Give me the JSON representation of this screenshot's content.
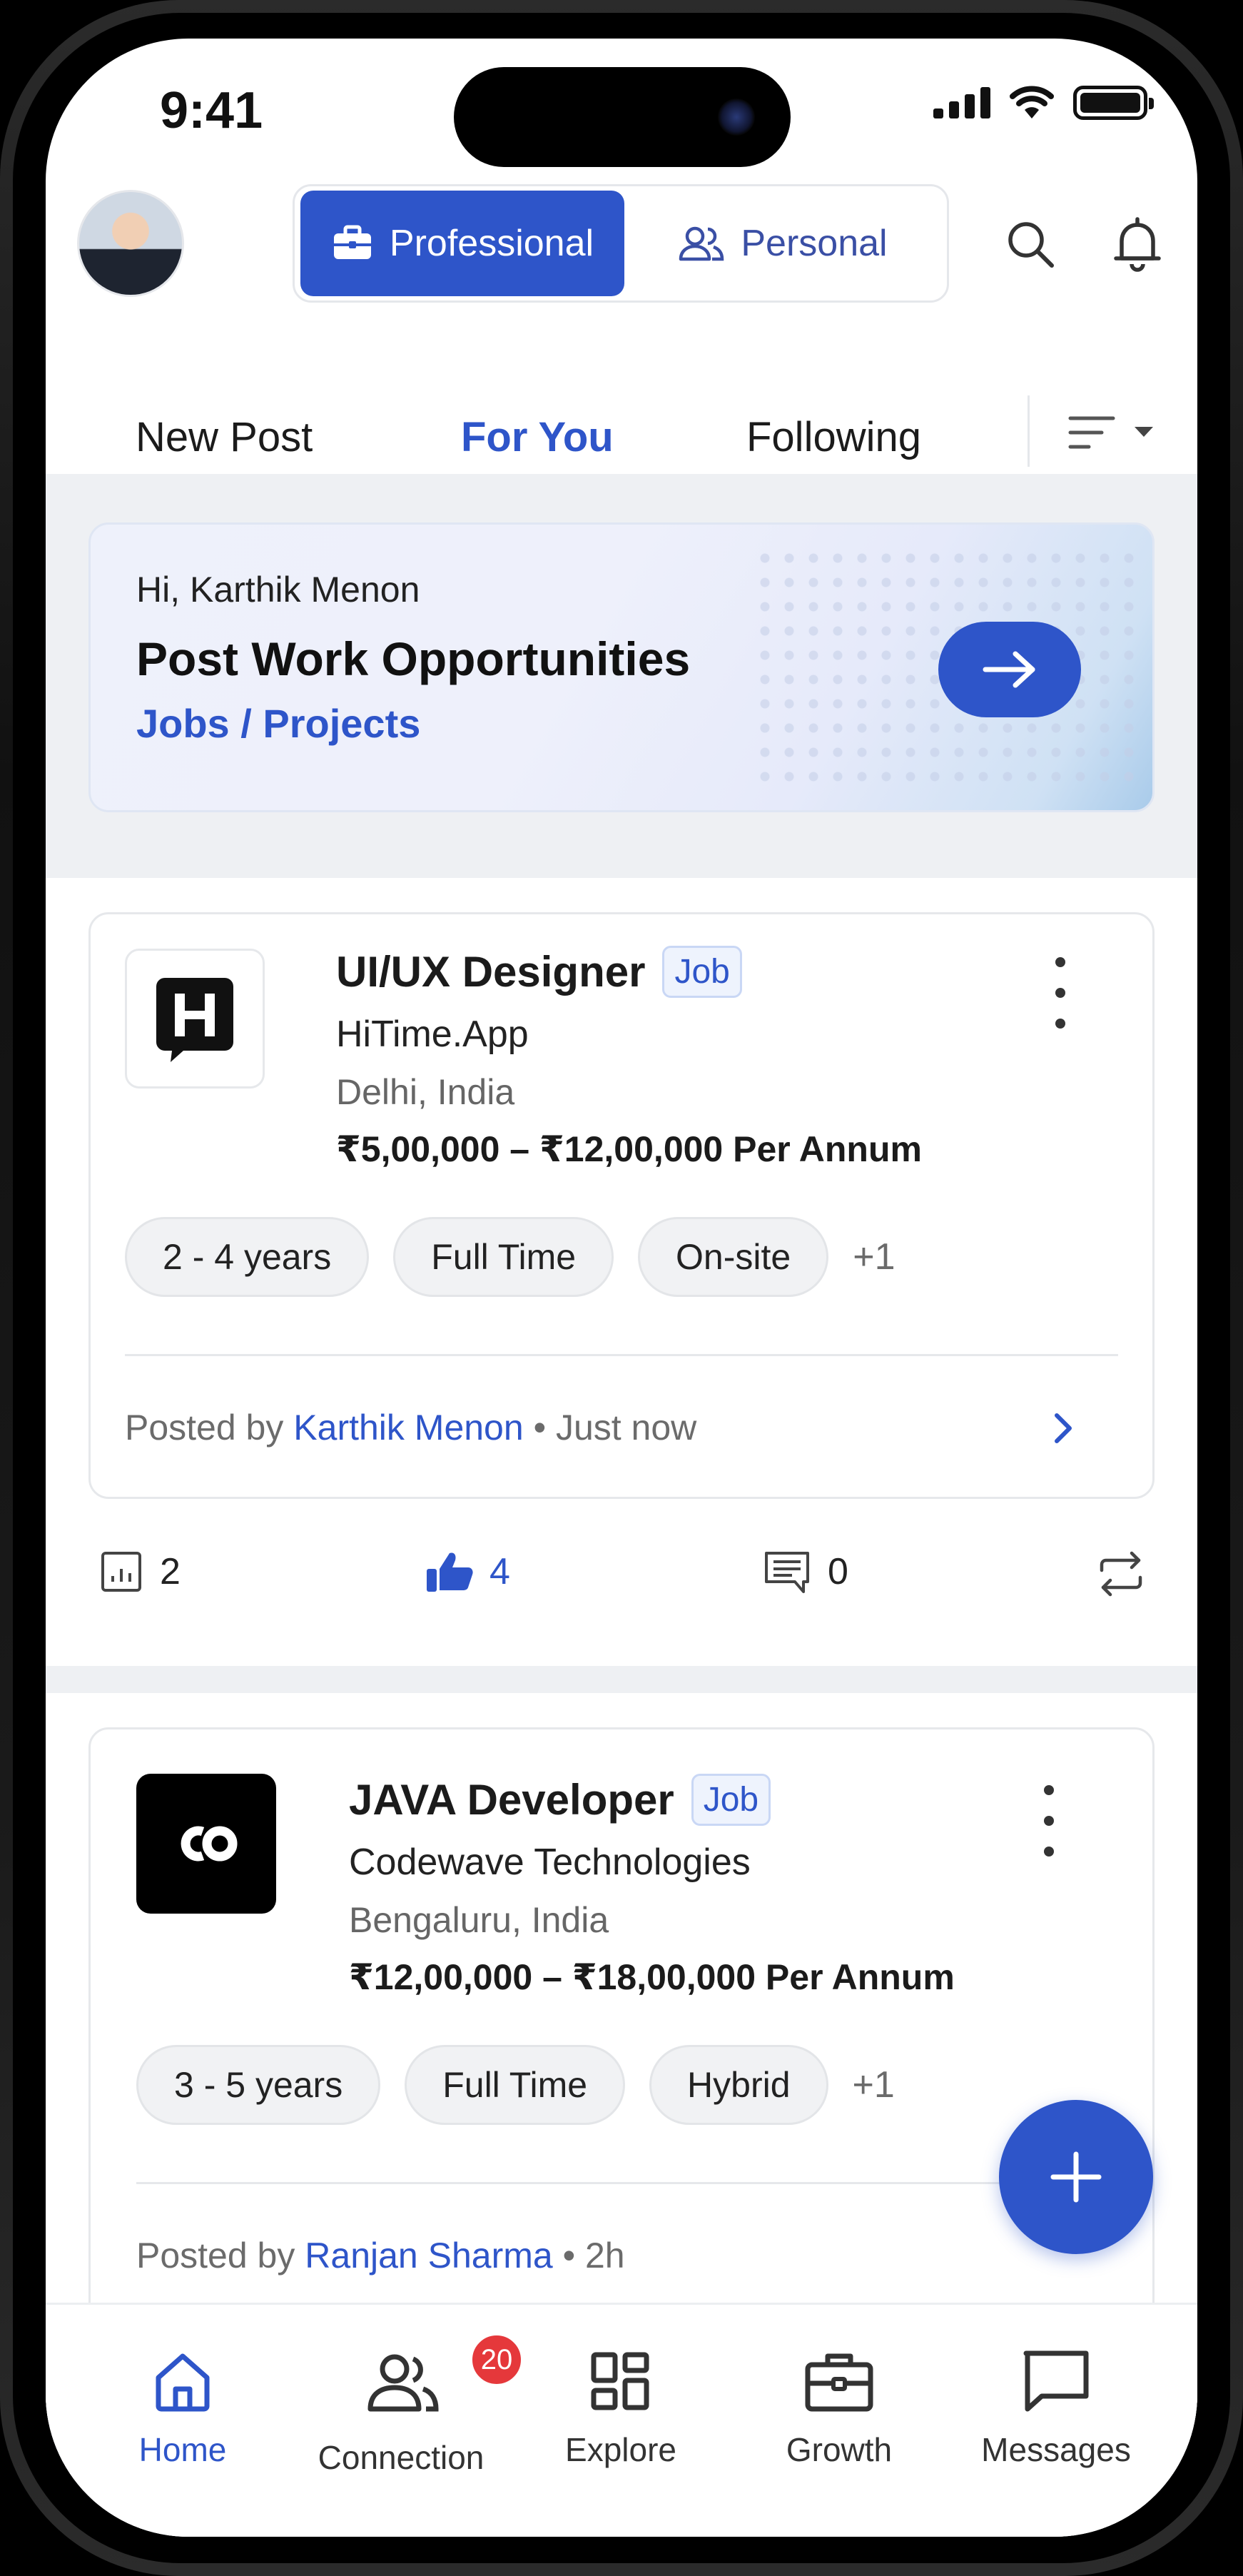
{
  "status_bar": {
    "time": "9:41"
  },
  "header": {
    "segments": [
      {
        "label": "Professional",
        "active": true
      },
      {
        "label": "Personal",
        "active": false
      }
    ]
  },
  "tabs": [
    {
      "label": "New Post",
      "active": false
    },
    {
      "label": "For You",
      "active": true
    },
    {
      "label": "Following",
      "active": false
    }
  ],
  "promo": {
    "greeting": "Hi, Karthik Menon",
    "title": "Post Work Opportunities",
    "subtitle": "Jobs / Projects"
  },
  "posts": [
    {
      "title": "UI/UX Designer",
      "badge": "Job",
      "company": "HiTime.App",
      "location": "Delhi, India",
      "salary": "₹5,00,000 – ₹12,00,000 Per Annum",
      "chips": [
        "2 - 4 years",
        "Full Time",
        "On-site"
      ],
      "more": "+1",
      "posted_prefix": "Posted by",
      "posted_by": "Karthik Menon",
      "posted_time": " • Just now",
      "stats": {
        "views": "2",
        "likes": "4",
        "comments": "0"
      }
    },
    {
      "title": "JAVA Developer",
      "badge": "Job",
      "company": "Codewave Technologies",
      "location": "Bengaluru, India",
      "salary": "₹12,00,000 – ₹18,00,000 Per Annum",
      "chips": [
        "3 - 5 years",
        "Full Time",
        "Hybrid"
      ],
      "more": "+1",
      "posted_prefix": "Posted by",
      "posted_by": "Ranjan Sharma",
      "posted_time": " • 2h"
    }
  ],
  "bottom_nav": [
    {
      "label": "Home",
      "icon": "home-icon",
      "active": true
    },
    {
      "label": "Connection",
      "icon": "connection-icon",
      "badge": "20"
    },
    {
      "label": "Explore",
      "icon": "explore-icon"
    },
    {
      "label": "Growth",
      "icon": "briefcase-icon"
    },
    {
      "label": "Messages",
      "icon": "message-icon"
    }
  ],
  "colors": {
    "accent": "#2e55c9",
    "badge_red": "#e5383b"
  }
}
